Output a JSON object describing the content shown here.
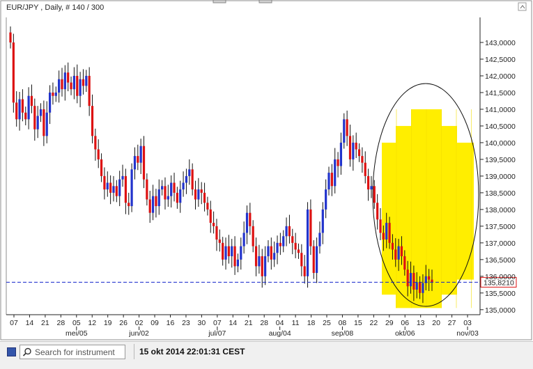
{
  "chart_title": "EUR/JPY , Daily, # 140 / 300",
  "current_price": "135,8210",
  "colors": {
    "up": "#2233cc",
    "down": "#dd1111",
    "highlight": "#ffee00",
    "price_line": "#1122cc",
    "price_box": "#dd1111"
  },
  "chart_data": {
    "type": "candlestick",
    "title": "EUR/JPY , Daily, # 140 / 300",
    "ylim": [
      134.85,
      143.75
    ],
    "y_ticks": [
      "135,0000",
      "135,5000",
      "136,0000",
      "136,5000",
      "137,0000",
      "137,5000",
      "138,0000",
      "138,5000",
      "139,0000",
      "139,5000",
      "140,0000",
      "140,5000",
      "141,0000",
      "141,5000",
      "142,0000",
      "142,5000",
      "143,0000"
    ],
    "y_tick_values": [
      135,
      135.5,
      136,
      136.5,
      137,
      137.5,
      138,
      138.5,
      139,
      139.5,
      140,
      140.5,
      141,
      141.5,
      142,
      142.5,
      143
    ],
    "x_ticks": [
      "07",
      "14",
      "21",
      "28",
      "05",
      "12",
      "19",
      "26",
      "02",
      "09",
      "16",
      "23",
      "30",
      "07",
      "14",
      "21",
      "28",
      "04",
      "11",
      "18",
      "25",
      "08",
      "15",
      "22",
      "29",
      "06",
      "13",
      "20",
      "27",
      "03"
    ],
    "x_month_labels": [
      "mei/05",
      "jun/02",
      "jul/07",
      "aug/04",
      "sep/08",
      "okt/06",
      "nov/03"
    ],
    "price_line": 135.821,
    "grid": false,
    "closes": [
      143.0,
      141.2,
      140.7,
      141.3,
      140.9,
      140.7,
      141.4,
      141.1,
      140.4,
      140.8,
      141.0,
      140.2,
      140.9,
      141.5,
      141.4,
      141.5,
      141.9,
      141.6,
      142.1,
      141.8,
      141.6,
      142.0,
      141.4,
      141.9,
      141.7,
      142.0,
      141.1,
      140.2,
      139.8,
      139.5,
      139.0,
      138.6,
      138.8,
      138.5,
      138.7,
      138.4,
      138.9,
      139.0,
      138.2,
      138.1,
      139.2,
      139.6,
      139.4,
      139.9,
      138.9,
      138.3,
      137.9,
      138.4,
      138.1,
      138.6,
      138.7,
      138.3,
      138.4,
      138.8,
      138.5,
      138.2,
      138.6,
      138.8,
      139.0,
      139.2,
      138.6,
      138.3,
      138.6,
      138.5,
      138.2,
      138.0,
      137.6,
      137.5,
      137.1,
      137.0,
      136.5,
      136.9,
      136.6,
      136.9,
      136.3,
      136.5,
      136.9,
      137.3,
      137.9,
      137.5,
      136.9,
      136.3,
      136.6,
      136.0,
      136.6,
      136.9,
      136.5,
      136.7,
      137.0,
      136.9,
      137.2,
      137.5,
      137.2,
      137.0,
      136.8,
      136.7,
      136.3,
      136.0,
      138.0,
      136.9,
      136.1,
      136.9,
      137.3,
      138.0,
      138.6,
      139.1,
      138.7,
      139.5,
      139.3,
      140.0,
      140.7,
      140.2,
      139.5,
      140.0,
      139.8,
      139.6,
      139.4,
      139.0,
      138.6,
      138.7,
      138.2,
      137.7,
      137.3,
      137.1,
      137.6,
      137.0,
      136.8,
      136.5,
      136.9,
      136.6,
      136.2,
      135.7,
      136.1,
      135.6,
      135.821,
      135.5,
      135.8,
      136.0,
      135.9,
      135.821
    ],
    "annotations": {
      "ellipse": "black ellipse around the last ~6 weeks (late Aug – mid Oct)",
      "highlight": "yellow stepped block around the recent decline"
    }
  },
  "bottom_bar": {
    "search_placeholder": "Search for instrument",
    "timestamp": "15 okt 2014 22:01:31 CEST"
  }
}
